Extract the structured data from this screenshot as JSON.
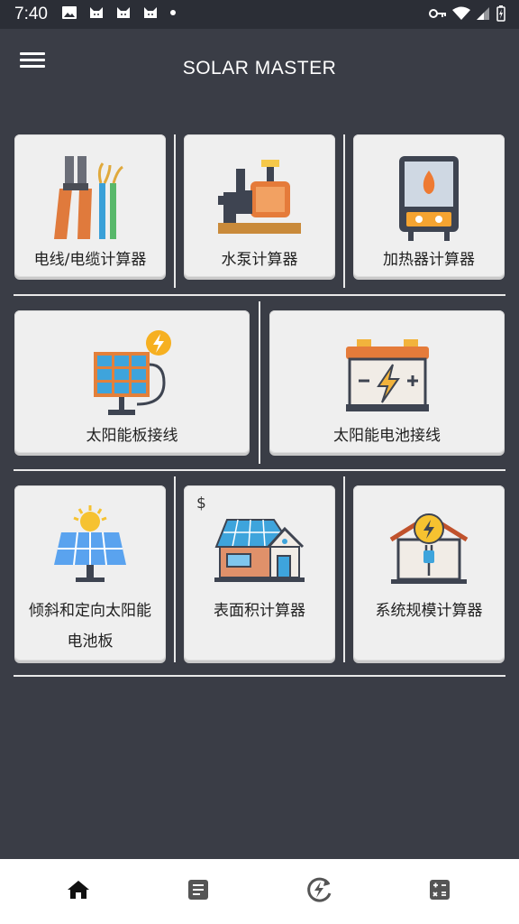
{
  "status": {
    "time": "7:40"
  },
  "app": {
    "title": "SOLAR MASTER"
  },
  "cards": {
    "wire": {
      "label": "电线/电缆计算器"
    },
    "pump": {
      "label": "水泵计算器"
    },
    "heater": {
      "label": "加热器计算器"
    },
    "panel_wiring": {
      "label": "太阳能板接线"
    },
    "battery_wiring": {
      "label": "太阳能电池接线"
    },
    "tilt": {
      "label_line1": "倾斜和定向太阳能",
      "label_line2": "电池板"
    },
    "surface": {
      "label": "表面积计算器",
      "badge": "$"
    },
    "system": {
      "label": "系统规模计算器"
    }
  },
  "nav": [
    "home-icon",
    "article-icon",
    "energy-cycle-icon",
    "calculator-icon"
  ]
}
